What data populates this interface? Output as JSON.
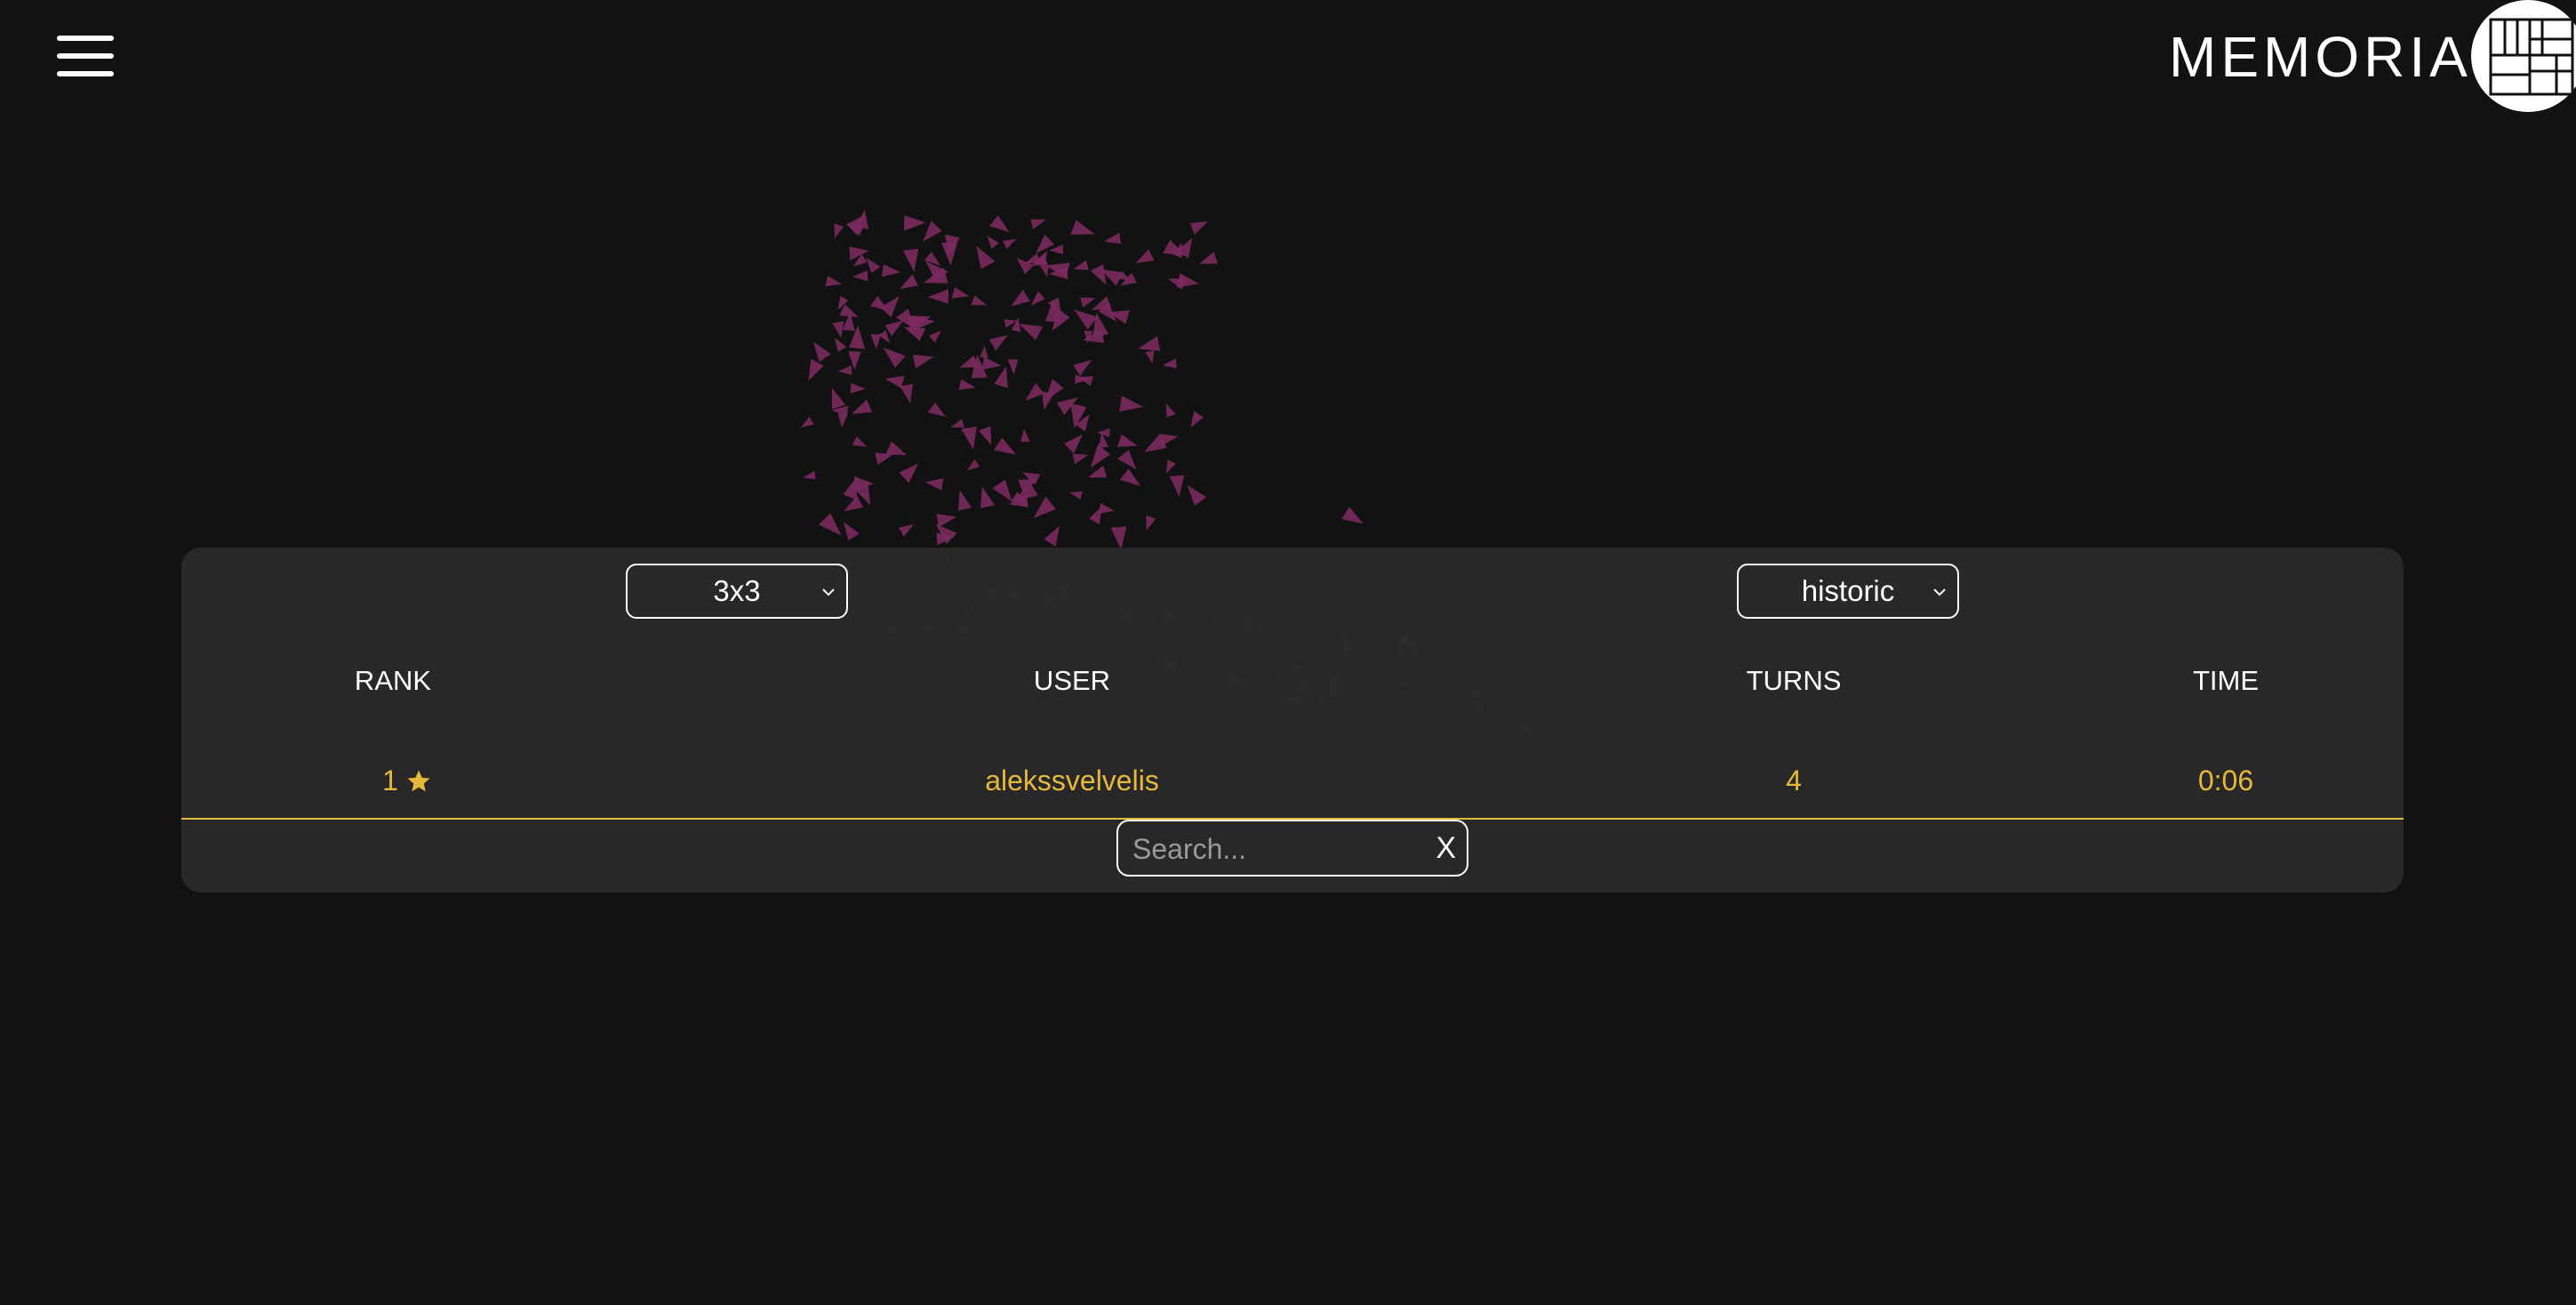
{
  "header": {
    "title": "MEMORIA",
    "menu_icon": "hamburger-menu-icon",
    "logo_icon": "grid-logo-icon"
  },
  "leaderboard": {
    "size_select": {
      "selected": "3x3"
    },
    "period_select": {
      "selected": "historic"
    },
    "columns": [
      "RANK",
      "USER",
      "TURNS",
      "TIME"
    ],
    "rows": [
      {
        "rank": "1",
        "rank_icon": "star-icon",
        "user": "alekssvelvelis",
        "turns": "4",
        "time": "0:06"
      }
    ],
    "search": {
      "placeholder": "Search...",
      "value": "",
      "clear_label": "X"
    }
  },
  "colors": {
    "background": "#121212",
    "panel": "#2a2a2a",
    "accent": "#e6b93a",
    "flock": "#7a2a5e"
  }
}
